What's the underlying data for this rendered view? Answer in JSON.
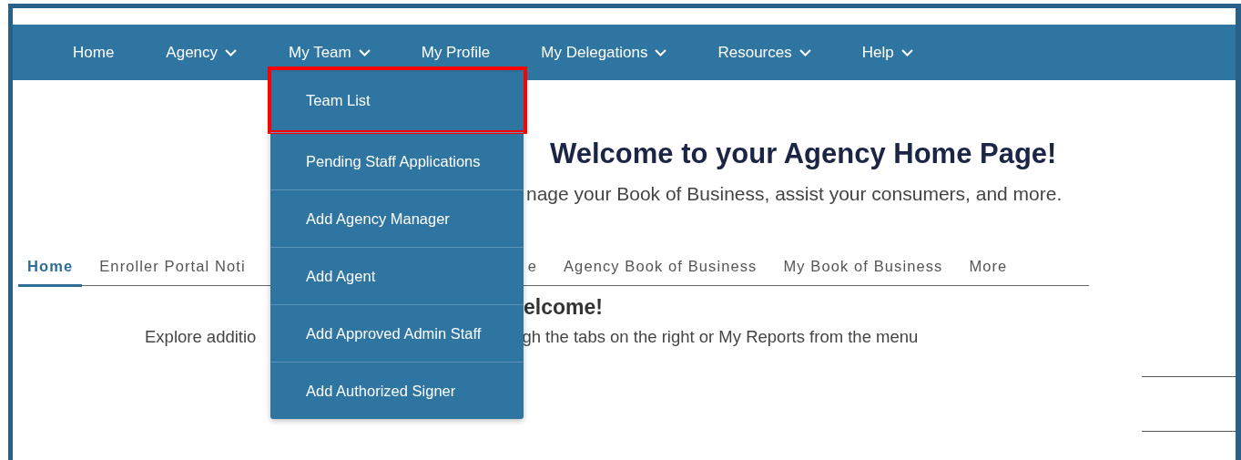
{
  "nav": [
    {
      "label": "Home",
      "dropdown": false
    },
    {
      "label": "Agency",
      "dropdown": true
    },
    {
      "label": "My Team",
      "dropdown": true,
      "menu": [
        {
          "label": "Team List",
          "highlighted": true
        },
        {
          "label": "Pending Staff Applications",
          "highlighted": false
        },
        {
          "label": "Add Agency Manager",
          "highlighted": false
        },
        {
          "label": "Add Agent",
          "highlighted": false
        },
        {
          "label": "Add Approved Admin Staff",
          "highlighted": false
        },
        {
          "label": "Add Authorized Signer",
          "highlighted": false
        }
      ]
    },
    {
      "label": "My Profile",
      "dropdown": false
    },
    {
      "label": "My Delegations",
      "dropdown": true
    },
    {
      "label": "Resources",
      "dropdown": true
    },
    {
      "label": "Help",
      "dropdown": true
    }
  ],
  "heading": "Welcome to your Agency Home Page!",
  "subtitle": "nage your Book of Business, assist your consumers, and more.",
  "tabs": [
    {
      "label": "Home",
      "selected": true
    },
    {
      "label": "Enroller Portal Noti",
      "selected": false
    },
    {
      "label": "e",
      "selected": false
    },
    {
      "label": "Agency Book of Business",
      "selected": false
    },
    {
      "label": "My Book of Business",
      "selected": false
    },
    {
      "label": "More",
      "selected": false
    }
  ],
  "section_heading": "elcome!",
  "paragraph": [
    "Explore additio",
    "gh the tabs on the right or My Reports from the menu"
  ]
}
